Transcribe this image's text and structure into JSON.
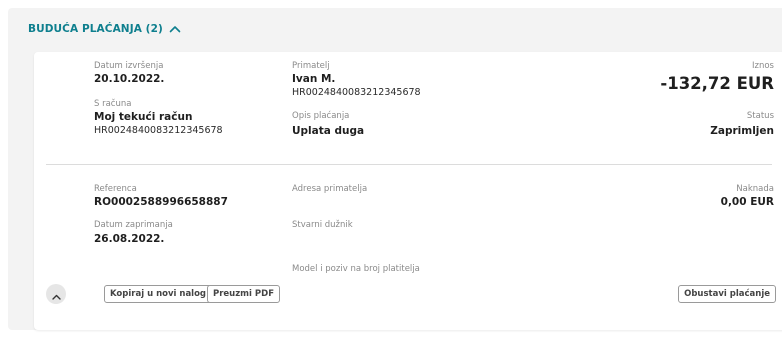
{
  "section": {
    "title": "BUDUĆA PLAĆANJA (2)",
    "toggle_icon": "chevron-up-icon",
    "accent_color": "#0e7f8e"
  },
  "payment": {
    "execution_date_label": "Datum izvršenja",
    "execution_date": "20.10.2022.",
    "from_account_label": "S računa",
    "from_account_name": "Moj tekući račun",
    "from_account_iban": "HR0024840083212345678",
    "recipient_label": "Primatelj",
    "recipient_name": "Ivan M.",
    "recipient_iban": "HR0024840083212345678",
    "description_label": "Opis plaćanja",
    "description": "Uplata duga",
    "amount_label": "Iznos",
    "amount": "-132,72 EUR",
    "status_label": "Status",
    "status": "Zaprimljen",
    "reference_label": "Referenca",
    "reference": "RO0002588996658887",
    "received_date_label": "Datum zaprimanja",
    "received_date": "26.08.2022.",
    "recipient_address_label": "Adresa primatelja",
    "actual_debtor_label": "Stvarni dužnik",
    "payer_model_label": "Model i poziv na broj platitelja",
    "fee_label": "Naknada",
    "fee": "0,00 EUR"
  },
  "actions": {
    "collapse_icon": "chevron-up-icon",
    "copy_label": "Kopiraj u novi nalog",
    "download_label": "Preuzmi PDF",
    "cancel_label": "Obustavi plaćanje"
  }
}
